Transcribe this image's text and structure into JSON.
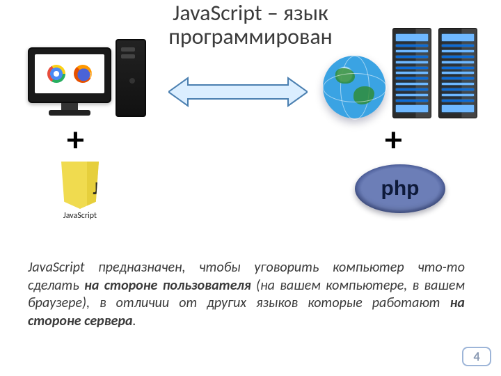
{
  "title_line1": "JavaScript – язык",
  "title_line2": "программирован",
  "plus": "+",
  "js": {
    "abbr": "JS",
    "caption": "JavaScript"
  },
  "php": {
    "label": "php"
  },
  "paragraph": {
    "p1": "JavaScript предназначен, чтобы уговорить компьютер что-то сделать ",
    "b1": "на стороне пользователя",
    "p2": " (на вашем компьютере, в вашем браузере), в отличии от других языков которые работают ",
    "b2": "на стороне сервера",
    "p3": "."
  },
  "page_number": "4",
  "icons": {
    "chrome": "chrome-icon",
    "firefox": "firefox-icon",
    "globe": "globe-icon",
    "server_rack": "server-rack-icon",
    "monitor": "monitor-icon",
    "pc_tower": "pc-tower-icon",
    "double_arrow": "double-arrow-icon",
    "js_shield": "js-shield-icon",
    "php_badge": "php-badge-icon"
  },
  "colors": {
    "js_yellow": "#f0db4f",
    "php_purple": "#6c7eb7",
    "arrow_stroke": "#4a7fb0",
    "arrow_fill": "#dbeeff"
  }
}
